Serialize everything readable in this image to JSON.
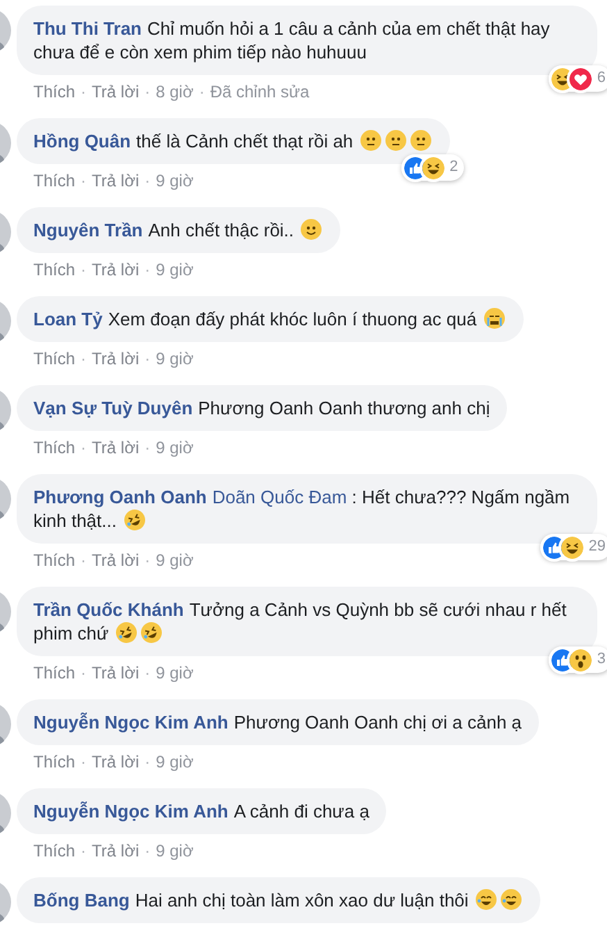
{
  "comments": [
    {
      "author": "Thu Thi Tran",
      "text": "Chỉ muốn hỏi a 1 câu a cảnh của em chết thật hay chưa để e còn xem phim tiếp nào huhuuu",
      "reactions": {
        "icons": [
          {
            "kind": "haha"
          },
          {
            "kind": "love"
          }
        ],
        "count": "6"
      },
      "meta": [
        {
          "kind": "link",
          "text": "Thích"
        },
        {
          "kind": "sep",
          "text": "·"
        },
        {
          "kind": "link",
          "text": "Trả lời"
        },
        {
          "kind": "sep",
          "text": "·"
        },
        {
          "kind": "plain",
          "text": "8 giờ"
        },
        {
          "kind": "sep",
          "text": "·"
        },
        {
          "kind": "plain",
          "text": "Đã chỉnh sửa"
        }
      ]
    },
    {
      "author": "Hồng Quân",
      "text": "thế là Cảnh chết thạt rồi ah",
      "emojis": [
        {
          "kind": "neutral"
        },
        {
          "kind": "neutral"
        },
        {
          "kind": "neutral"
        }
      ],
      "reactions": {
        "icons": [
          {
            "kind": "like"
          },
          {
            "kind": "haha"
          }
        ],
        "count": "2"
      },
      "meta": [
        {
          "kind": "link",
          "text": "Thích"
        },
        {
          "kind": "sep",
          "text": "·"
        },
        {
          "kind": "link",
          "text": "Trả lời"
        },
        {
          "kind": "sep",
          "text": "·"
        },
        {
          "kind": "plain",
          "text": "9 giờ"
        }
      ]
    },
    {
      "author": "Nguyên Trần",
      "text": "Anh chết thậc rồi..",
      "emojis": [
        {
          "kind": "smile"
        }
      ],
      "meta": [
        {
          "kind": "link",
          "text": "Thích"
        },
        {
          "kind": "sep",
          "text": "·"
        },
        {
          "kind": "link",
          "text": "Trả lời"
        },
        {
          "kind": "sep",
          "text": "·"
        },
        {
          "kind": "plain",
          "text": "9 giờ"
        }
      ]
    },
    {
      "author": "Loan Tỷ",
      "text": "Xem đoạn đấy phát khóc luôn í thuong ac quá",
      "emojis": [
        {
          "kind": "cry"
        }
      ],
      "meta": [
        {
          "kind": "link",
          "text": "Thích"
        },
        {
          "kind": "sep",
          "text": "·"
        },
        {
          "kind": "link",
          "text": "Trả lời"
        },
        {
          "kind": "sep",
          "text": "·"
        },
        {
          "kind": "plain",
          "text": "9 giờ"
        }
      ]
    },
    {
      "author": "Vạn Sự Tuỳ Duyên",
      "text": "Phương Oanh Oanh thương anh chị",
      "meta": [
        {
          "kind": "link",
          "text": "Thích"
        },
        {
          "kind": "sep",
          "text": "·"
        },
        {
          "kind": "link",
          "text": "Trả lời"
        },
        {
          "kind": "sep",
          "text": "·"
        },
        {
          "kind": "plain",
          "text": "9 giờ"
        }
      ]
    },
    {
      "author": "Phương Oanh Oanh",
      "mention": "Doãn Quốc Đam",
      "text": ": Hết chưa??? Ngấm ngầm kinh thật...",
      "emojis": [
        {
          "kind": "rofl"
        }
      ],
      "reactions": {
        "icons": [
          {
            "kind": "like"
          },
          {
            "kind": "haha"
          }
        ],
        "count": "29"
      },
      "meta": [
        {
          "kind": "link",
          "text": "Thích"
        },
        {
          "kind": "sep",
          "text": "·"
        },
        {
          "kind": "link",
          "text": "Trả lời"
        },
        {
          "kind": "sep",
          "text": "·"
        },
        {
          "kind": "plain",
          "text": "9 giờ"
        }
      ]
    },
    {
      "author": "Trần Quốc Khánh",
      "text": "Tưởng a Cảnh vs Quỳnh bb sẽ cưới nhau r hết phim chứ",
      "emojis": [
        {
          "kind": "rofl"
        },
        {
          "kind": "rofl"
        }
      ],
      "reactions": {
        "icons": [
          {
            "kind": "like"
          },
          {
            "kind": "wow"
          }
        ],
        "count": "3"
      },
      "meta": [
        {
          "kind": "link",
          "text": "Thích"
        },
        {
          "kind": "sep",
          "text": "·"
        },
        {
          "kind": "link",
          "text": "Trả lời"
        },
        {
          "kind": "sep",
          "text": "·"
        },
        {
          "kind": "plain",
          "text": "9 giờ"
        }
      ]
    },
    {
      "author": "Nguyễn Ngọc Kim Anh",
      "text": "Phương Oanh Oanh chị ơi a cảnh ạ",
      "meta": [
        {
          "kind": "link",
          "text": "Thích"
        },
        {
          "kind": "sep",
          "text": "·"
        },
        {
          "kind": "link",
          "text": "Trả lời"
        },
        {
          "kind": "sep",
          "text": "·"
        },
        {
          "kind": "plain",
          "text": "9 giờ"
        }
      ]
    },
    {
      "author": "Nguyễn Ngọc Kim Anh",
      "text": "A cảnh đi chưa ạ",
      "meta": [
        {
          "kind": "link",
          "text": "Thích"
        },
        {
          "kind": "sep",
          "text": "·"
        },
        {
          "kind": "link",
          "text": "Trả lời"
        },
        {
          "kind": "sep",
          "text": "·"
        },
        {
          "kind": "plain",
          "text": "9 giờ"
        }
      ]
    },
    {
      "author": "Bống Bang",
      "text": "Hai anh chị toàn làm xôn xao dư luận thôi",
      "emojis": [
        {
          "kind": "grin"
        },
        {
          "kind": "grin"
        }
      ]
    }
  ]
}
